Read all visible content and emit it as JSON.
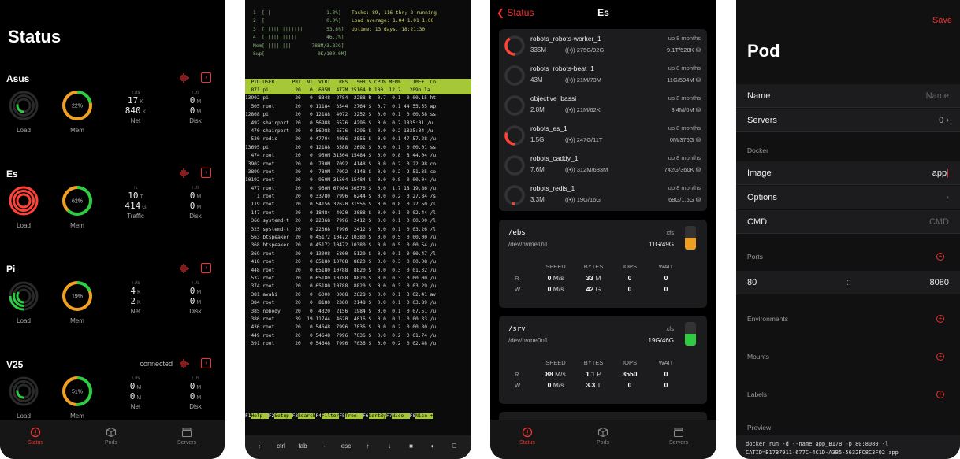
{
  "status_screen": {
    "title": "Status",
    "labels": {
      "load": "Load",
      "mem": "Mem",
      "net": "Net",
      "disk": "Disk",
      "traffic": "Traffic"
    },
    "arrows": {
      "up_down": "↑↓",
      "updown_s": "↑↓/s"
    },
    "servers": [
      {
        "name": "Asus",
        "connected": "",
        "mem_pct": "22%",
        "mem_value": 0.22,
        "load_color": "#2ecc40",
        "mem_color": "#f0a020",
        "net_label": "Net",
        "metric_a": [
          "17",
          "K"
        ],
        "metric_b": [
          "840",
          "K"
        ],
        "disk_a": [
          "0",
          "M"
        ],
        "disk_b": [
          "0",
          "M"
        ]
      },
      {
        "name": "Es",
        "connected": "",
        "mem_pct": "62%",
        "mem_value": 0.62,
        "load_color": "#ff4136",
        "mem_color": "#f0a020",
        "net_label": "Traffic",
        "metric_a": [
          "10",
          "T"
        ],
        "metric_b": [
          "414",
          "G"
        ],
        "disk_a": [
          "0",
          "M"
        ],
        "disk_b": [
          "0",
          "M"
        ]
      },
      {
        "name": "Pi",
        "connected": "",
        "mem_pct": "19%",
        "mem_value": 0.19,
        "load_color": "#2ecc40",
        "mem_color": "#f0a020",
        "net_label": "Net",
        "metric_a": [
          "4",
          "K"
        ],
        "metric_b": [
          "2",
          "K"
        ],
        "disk_a": [
          "0",
          "M"
        ],
        "disk_b": [
          "0",
          "M"
        ]
      },
      {
        "name": "V25",
        "connected": "connected",
        "mem_pct": "51%",
        "mem_value": 0.51,
        "load_color": "#2ecc40",
        "mem_color": "#f0a020",
        "net_label": "Net",
        "metric_a": [
          "0",
          "M"
        ],
        "metric_b": [
          "0",
          "M"
        ],
        "disk_a": [
          "0",
          "M"
        ],
        "disk_b": [
          "0",
          "M"
        ]
      }
    ],
    "tabs": [
      "Status",
      "Pods",
      "Servers"
    ]
  },
  "htop": {
    "meters": [
      "1  [||                   1.3%]",
      "2  [                     0.0%]",
      "3  [|||||||||||||        53.8%]",
      "4  [|||||||||||          46.7%]",
      "Mem[|||||||||       788M/3.83G]",
      "Swp[                  0K/100.0M]"
    ],
    "summary": [
      "Tasks: 89, 116 thr; 2 running",
      "Load average: 1.04 1.01 1.00",
      "Uptime: 13 days, 18:21:30"
    ],
    "header": "  PID USER      PRI  NI  VIRT   RES   SHR S CPU% MEM%   TIME+  Co",
    "rows": [
      "  871 pi         20   0  685M  477M 25164 R 100. 12.2   209h la",
      "13902 pi         20   0  8348  2784  2288 R  0.7  0.1  0:00.15 ht",
      "  505 root       20   0 11184  3544  2764 S  0.7  0.1 44:55.55 wp",
      "12868 pi         20   0 12188  4072  3252 S  0.0  0.1  0:00.58 ss",
      "  492 shairport  20   0 56988  6576  4296 S  0.0  0.2 1835:01 /u",
      "  470 shairport  20   0 56988  6576  4296 S  0.0  0.2 1835:04 /u",
      "  520 redis      20   0 47704  4056  2856 S  0.0  0.1 47:57.28 /u",
      "13695 pi         20   0 12188  3588  2692 S  0.0  0.1  0:00.01 ss",
      "  474 root       20   0  950M 31504 15484 S  0.0  0.8  8:44.04 /u",
      " 3902 root       20   0  780M  7092  4148 S  0.0  0.2  0:22.98 co",
      " 3899 root       20   0  780M  7092  4148 S  0.0  0.2  2:51.35 co",
      "10192 root       20   0  950M 31504 15484 S  0.0  0.8  0:00.04 /u",
      "  477 root       20   0  960M 67984 30576 S  0.0  1.7 18:19.86 /u",
      "    1 root       20   0 33780  7996  6244 S  0.0  0.2  0:27.84 /s",
      "  119 root       20   0 54156 32620 31556 S  0.0  0.8  0:22.50 /l",
      "  147 root       20   0 18484  4020  3088 S  0.0  0.1  0:02.44 /l",
      "  366 systemd-t  20   0 22368  7996  2412 S  0.0  0.1  0:00.00 /l",
      "  325 systemd-t  20   0 22368  7996  2412 S  0.0  0.1  0:03.26 /l",
      "  563 btspeaker  20   0 45172 10472 10380 S  0.0  0.5  0:00.00 /u",
      "  368 btspeaker  20   0 45172 10472 10380 S  0.0  0.5  0:00.54 /u",
      "  369 root       20   0 13008  5800  5120 S  0.0  0.1  0:00.47 /l",
      "  418 root       20   0 65180 10788  8820 S  0.0  0.3  0:00.08 /u",
      "  448 root       20   0 65180 10788  8820 S  0.0  0.3  0:01.32 /u",
      "  532 root       20   0 65180 10788  8820 S  0.0  0.3  0:00.00 /u",
      "  374 root       20   0 65180 10788  8820 S  0.0  0.3  0:03.29 /u",
      "  381 avahi      20   0  6000  3068  2628 S  0.0  0.1  3:02.41 av",
      "  384 root       20   0  8180  2360  2148 S  0.0  0.1  0:03.89 /u",
      "  385 nobody     20   0  4320  2156  1984 S  0.0  0.1  0:07.51 /u",
      "  386 root       39  19 11744  4620  4016 S  0.0  0.1  0:00.33 /u",
      "  436 root       20   0 54648  7996  7036 S  0.0  0.2  0:00.80 /u",
      "  449 root       20   0 54648  7996  7036 S  0.0  0.2  0:01.74 /u",
      "  391 root       20   0 54648  7996  7036 S  0.0  0.2  0:02.48 /u"
    ],
    "fkeys": [
      [
        "F1",
        "Help  "
      ],
      [
        "F2",
        "Setup "
      ],
      [
        "F3",
        "Search"
      ],
      [
        "F4",
        "Filter"
      ],
      [
        "F5",
        "Tree  "
      ],
      [
        "F6",
        "SortBy"
      ],
      [
        "F7",
        "Nice -"
      ],
      [
        "F8",
        "Nice +"
      ]
    ],
    "keys": [
      "‹",
      "ctrl",
      "tab",
      "-",
      "esc",
      "↑",
      "↓",
      "■",
      "◐",
      "⎕"
    ]
  },
  "es_screen": {
    "back_label": "Status",
    "title": "Es",
    "containers": [
      {
        "name": "robots_robots-worker_1",
        "uptime": "up 8 months",
        "mem": "335M",
        "net": "275G/92G",
        "io": "9.1T/528K",
        "load": 0.4,
        "color": "#ff4136"
      },
      {
        "name": "robots_robots-beat_1",
        "uptime": "up 8 months",
        "mem": "43M",
        "net": "21M/73M",
        "io": "11G/594M",
        "load": 0.0,
        "color": "#ff4136"
      },
      {
        "name": "objective_bassi",
        "uptime": "up 8 months",
        "mem": "2.8M",
        "net": "21M/62K",
        "io": "3.4M/0M",
        "load": 0.0,
        "color": "#ff4136"
      },
      {
        "name": "robots_es_1",
        "uptime": "up 8 months",
        "mem": "1.5G",
        "net": "247G/11T",
        "io": "0M/376G",
        "load": 0.3,
        "color": "#ff4136"
      },
      {
        "name": "robots_caddy_1",
        "uptime": "up 8 months",
        "mem": "7.6M",
        "net": "312M/683M",
        "io": "742G/360K",
        "load": 0.0,
        "color": "#ff4136"
      },
      {
        "name": "robots_redis_1",
        "uptime": "up 8 months",
        "mem": "3.3M",
        "net": "19G/16G",
        "io": "68G/1.6G",
        "load": 0.05,
        "color": "#ff4136"
      }
    ],
    "disk_headers": [
      "SPEED",
      "BYTES",
      "IOPS",
      "WAIT"
    ],
    "rw": [
      "R",
      "W"
    ],
    "disks": [
      {
        "mount": "/ebs",
        "device": "/dev/nvme1n1",
        "fs": "xfs",
        "size": "11G/49G",
        "usage": 0.22,
        "color": "#f0a020",
        "r": [
          "0 M/s",
          "33 M",
          "0",
          "0"
        ],
        "w": [
          "0 M/s",
          "42 G",
          "0",
          "0"
        ]
      },
      {
        "mount": "/srv",
        "device": "/dev/nvme0n1",
        "fs": "xfs",
        "size": "19G/46G",
        "usage": 0.41,
        "color": "#2ecc40",
        "r": [
          "88 M/s",
          "1.1 P",
          "3550",
          "0"
        ],
        "w": [
          "0 M/s",
          "3.3 T",
          "0",
          "0"
        ]
      }
    ]
  },
  "pod_screen": {
    "save": "Save",
    "title": "Pod",
    "name_label": "Name",
    "name_placeholder": "Name",
    "servers_label": "Servers",
    "servers_value": "0",
    "docker_section": "Docker",
    "image_label": "Image",
    "image_value": "app",
    "options_label": "Options",
    "cmd_label": "CMD",
    "cmd_placeholder": "CMD",
    "ports_section": "Ports",
    "port_host": "80",
    "port_sep": ":",
    "port_container": "8080",
    "env_section": "Environments",
    "mounts_section": "Mounts",
    "labels_section": "Labels",
    "preview_section": "Preview",
    "preview_text": "docker run -d --name app_B17B -p 80:8080 -l\nCATID=B17B7911-677C-4C1D-A3B5-5632FC8C3F02 app"
  }
}
